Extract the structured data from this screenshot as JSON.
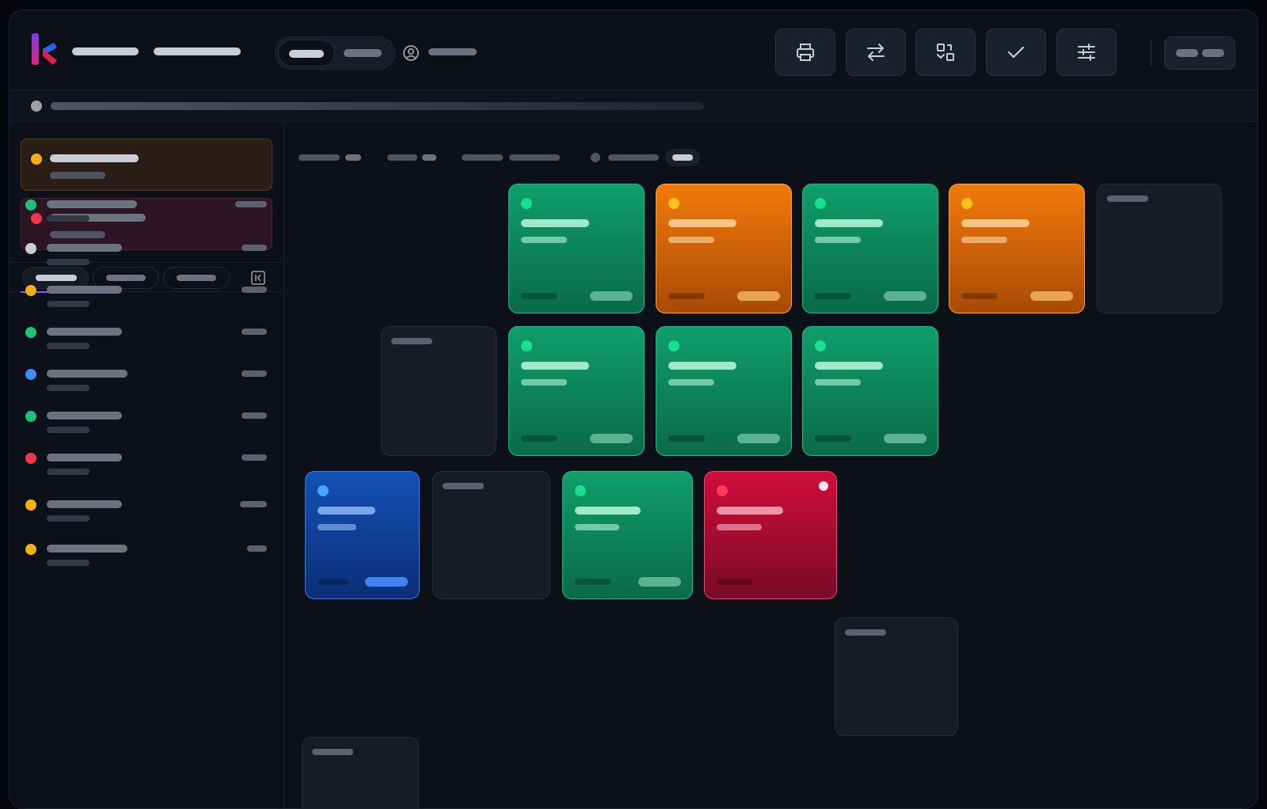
{
  "app": {
    "accent": "#8b5cf6"
  },
  "toolbar": {
    "tools": [
      {
        "name": "print-icon"
      },
      {
        "name": "swap-arrows-icon"
      },
      {
        "name": "layout-icon"
      },
      {
        "name": "check-icon"
      },
      {
        "name": "sliders-icon"
      }
    ]
  },
  "sidebar": {
    "alerts": [
      {
        "status": "warning",
        "color": "#f5b014"
      },
      {
        "status": "error",
        "color": "#f0364f"
      }
    ],
    "items": [
      {
        "color": "#18c27c"
      },
      {
        "color": "#c9ced6"
      },
      {
        "color": "#f5b014"
      },
      {
        "color": "#18c27c"
      },
      {
        "color": "#3b8cf5"
      },
      {
        "color": "#18c27c"
      },
      {
        "color": "#f0364f"
      },
      {
        "color": "#f5b014"
      },
      {
        "color": "#f5b014"
      }
    ]
  },
  "board": {
    "card_colors": {
      "green": "#0f9e6c",
      "orange": "#f27a0a",
      "blue": "#1450b4",
      "red": "#d00d3a",
      "ghost": "#161b25"
    }
  }
}
